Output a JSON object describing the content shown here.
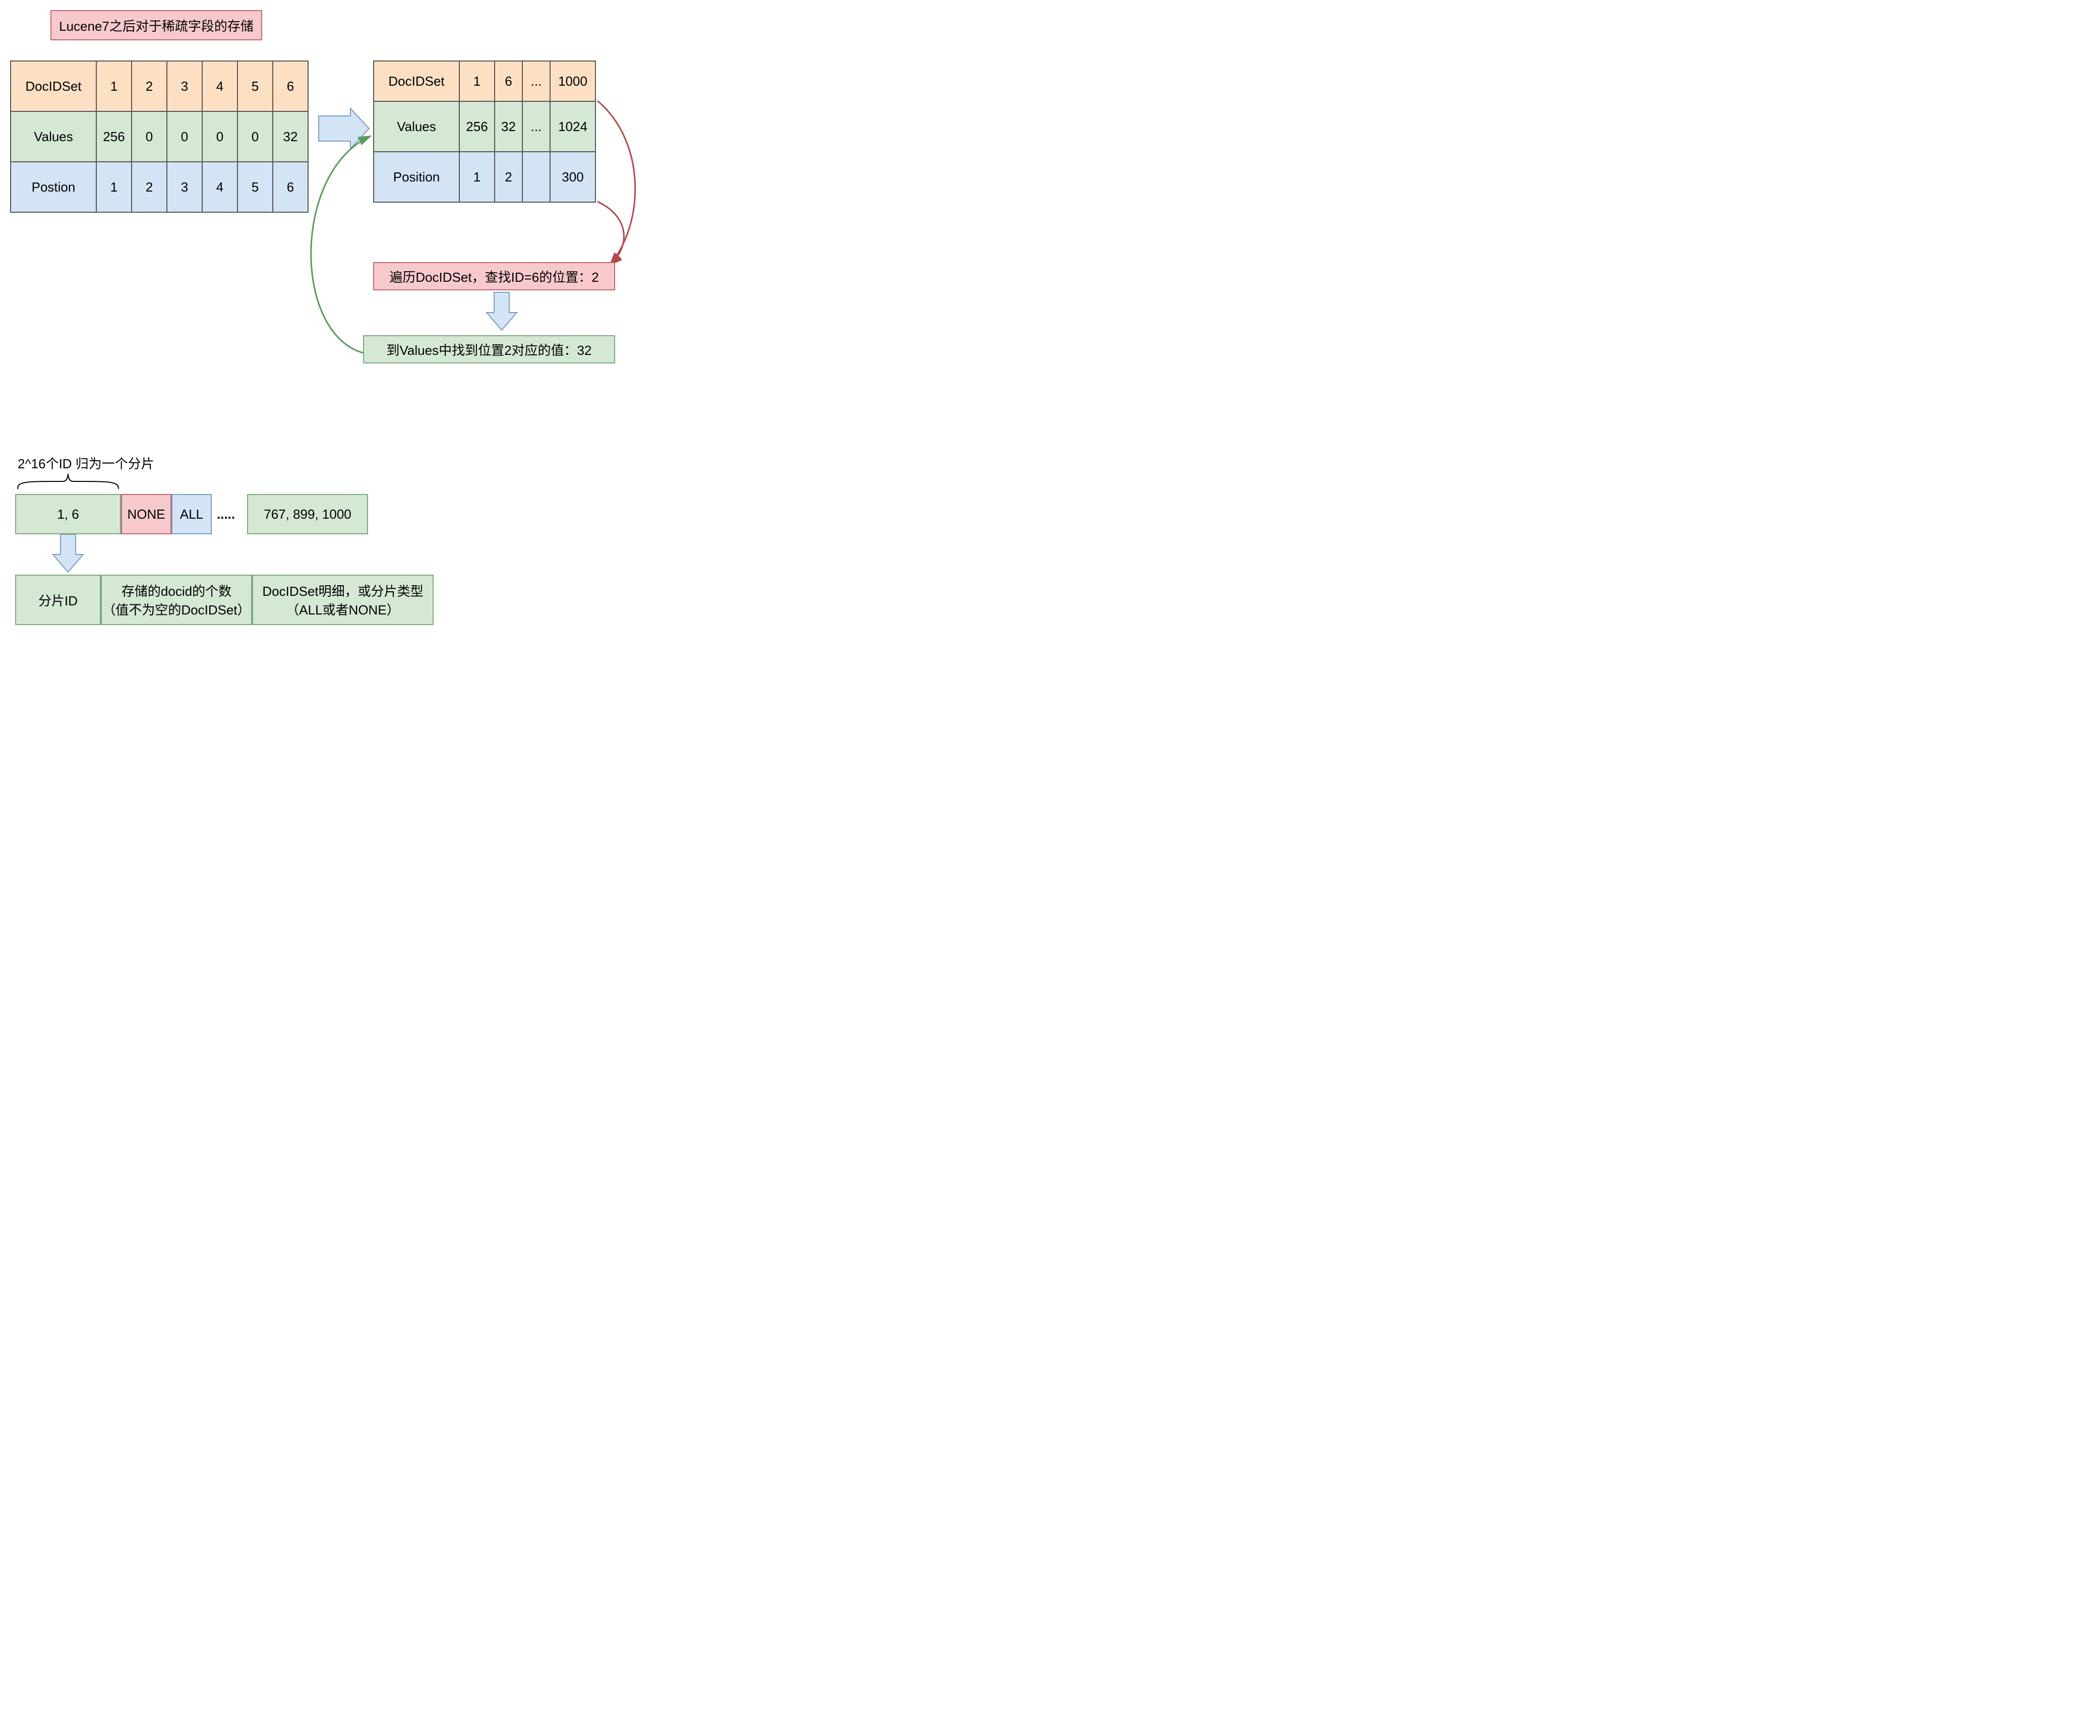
{
  "title": "Lucene7之后对于稀疏字段的存储",
  "left_table": {
    "rows": [
      {
        "label": "DocIDSet",
        "cells": [
          "1",
          "2",
          "3",
          "4",
          "5",
          "6"
        ]
      },
      {
        "label": "Values",
        "cells": [
          "256",
          "0",
          "0",
          "0",
          "0",
          "32"
        ]
      },
      {
        "label": "Postion",
        "cells": [
          "1",
          "2",
          "3",
          "4",
          "5",
          "6"
        ]
      }
    ]
  },
  "right_table": {
    "rows": [
      {
        "label": "DocIDSet",
        "cells": [
          "1",
          "6",
          "...",
          "1000"
        ]
      },
      {
        "label": "Values",
        "cells": [
          "256",
          "32",
          "...",
          "1024"
        ]
      },
      {
        "label": "Position",
        "cells": [
          "1",
          "2",
          "",
          "300"
        ]
      }
    ]
  },
  "callout1": "遍历DocIDSet，查找ID=6的位置：2",
  "callout2": "到Values中找到位置2对应的值：32",
  "brace_label": "2^16个ID 归为一个分片",
  "shards": {
    "cells": [
      "1, 6",
      "NONE",
      "ALL",
      ".....",
      "767, 899, 1000"
    ]
  },
  "shard_detail": {
    "cells": [
      "分片ID",
      "存储的docid的个数\n（值不为空的DocIDSet）",
      "DocIDSet明细，或分片类型\n（ALL或者NONE）"
    ]
  }
}
